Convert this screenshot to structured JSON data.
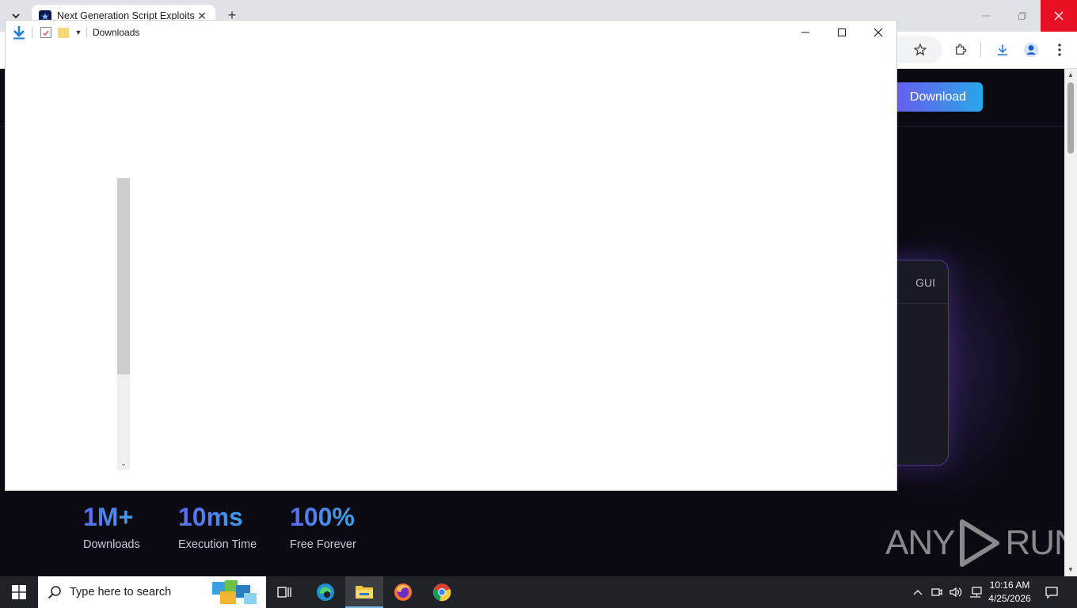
{
  "browser": {
    "tab_title": "Next Generation Script Exploits",
    "tab_close": "✕",
    "new_tab": "+"
  },
  "explorer": {
    "title": "Downloads"
  },
  "page": {
    "download_button": "Download",
    "card_tab": "GUI",
    "stats": [
      {
        "value": "1M+",
        "label": "Downloads"
      },
      {
        "value": "10ms",
        "label": "Execution Time"
      },
      {
        "value": "100%",
        "label": "Free Forever"
      }
    ],
    "watermark_left": "ANY",
    "watermark_right": "RUN"
  },
  "taskbar": {
    "search_placeholder": "Type here to search",
    "time": "10:16 AM",
    "date": "4/25/2026"
  },
  "colors": {
    "accent_gradient_start": "#6a5cf0",
    "accent_gradient_end": "#2aa6e8",
    "page_background": "#0b0a12",
    "close_red": "#e81123"
  }
}
